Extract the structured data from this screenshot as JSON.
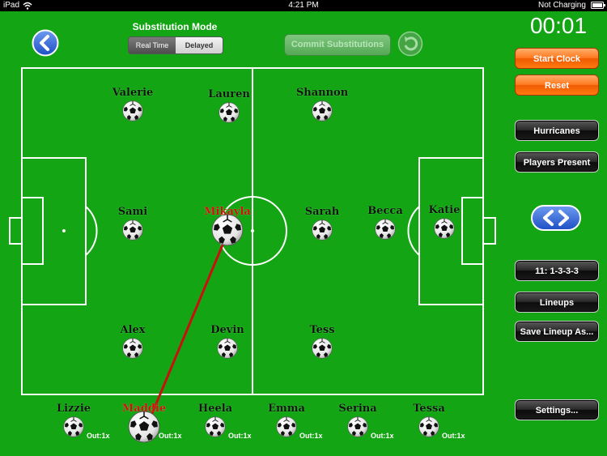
{
  "status_bar": {
    "device": "iPad",
    "time": "4:21 PM",
    "battery": "Not Charging"
  },
  "clock": "00:01",
  "substitution": {
    "title": "Substitution Mode",
    "options": [
      "Real Time",
      "Delayed"
    ],
    "selected": "Real Time",
    "commit_label": "Commit Substitutions"
  },
  "buttons": {
    "start_clock": "Start Clock",
    "reset": "Reset",
    "team": "Hurricanes",
    "players_present": "Players Present",
    "formation": "11: 1-3-3-3",
    "lineups": "Lineups",
    "save_lineup": "Save Lineup As...",
    "settings": "Settings..."
  },
  "field_players": [
    {
      "name": "Valerie",
      "selected": false
    },
    {
      "name": "Lauren",
      "selected": false
    },
    {
      "name": "Shannon",
      "selected": false
    },
    {
      "name": "Sami",
      "selected": false
    },
    {
      "name": "Mikayla",
      "selected": true
    },
    {
      "name": "Sarah",
      "selected": false
    },
    {
      "name": "Becca",
      "selected": false
    },
    {
      "name": "Katie",
      "selected": false
    },
    {
      "name": "Alex",
      "selected": false
    },
    {
      "name": "Devin",
      "selected": false
    },
    {
      "name": "Tess",
      "selected": false
    }
  ],
  "bench_players": [
    {
      "name": "Lizzie",
      "out": "Out:1x",
      "selected": false
    },
    {
      "name": "Maddie",
      "out": "Out:1x",
      "selected": true
    },
    {
      "name": "Heela",
      "out": "Out:1x",
      "selected": false
    },
    {
      "name": "Emma",
      "out": "Out:1x",
      "selected": false
    },
    {
      "name": "Serina",
      "out": "Out:1x",
      "selected": false
    },
    {
      "name": "Tessa",
      "out": "Out:1x",
      "selected": false
    }
  ],
  "colors": {
    "field_green": "#14a514",
    "selected_name": "#d01010",
    "substitution_line": "#c81010",
    "accent_blue": "#2a62d8"
  },
  "icons": {
    "back": "chevron-left-icon",
    "undo": "undo-arrow-icon",
    "swap": "left-right-arrows-icon",
    "ball": "soccer-ball-icon"
  }
}
